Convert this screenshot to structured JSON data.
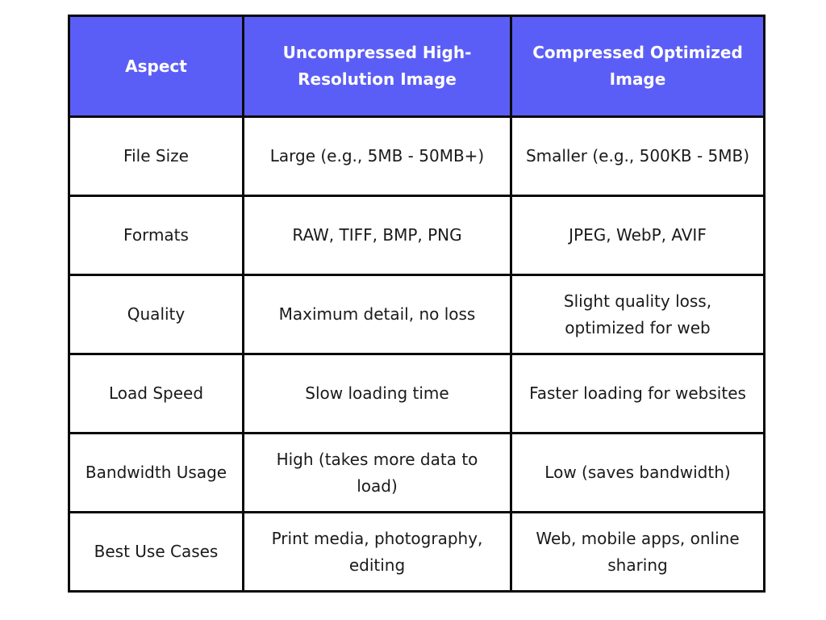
{
  "table": {
    "header_color": "#5b5ef6",
    "headers": [
      "Aspect",
      "Uncompressed High-Resolution Image",
      "Compressed Optimized Image"
    ],
    "rows": [
      [
        "File Size",
        "Large (e.g., 5MB - 50MB+)",
        "Smaller (e.g., 500KB - 5MB)"
      ],
      [
        "Formats",
        "RAW, TIFF, BMP, PNG",
        "JPEG, WebP, AVIF"
      ],
      [
        "Quality",
        "Maximum detail, no loss",
        "Slight quality loss, optimized for web"
      ],
      [
        "Load Speed",
        "Slow loading time",
        "Faster loading for websites"
      ],
      [
        "Bandwidth Usage",
        "High (takes more data to load)",
        "Low (saves bandwidth)"
      ],
      [
        "Best Use Cases",
        "Print media, photography, editing",
        "Web, mobile apps, online sharing"
      ]
    ]
  }
}
